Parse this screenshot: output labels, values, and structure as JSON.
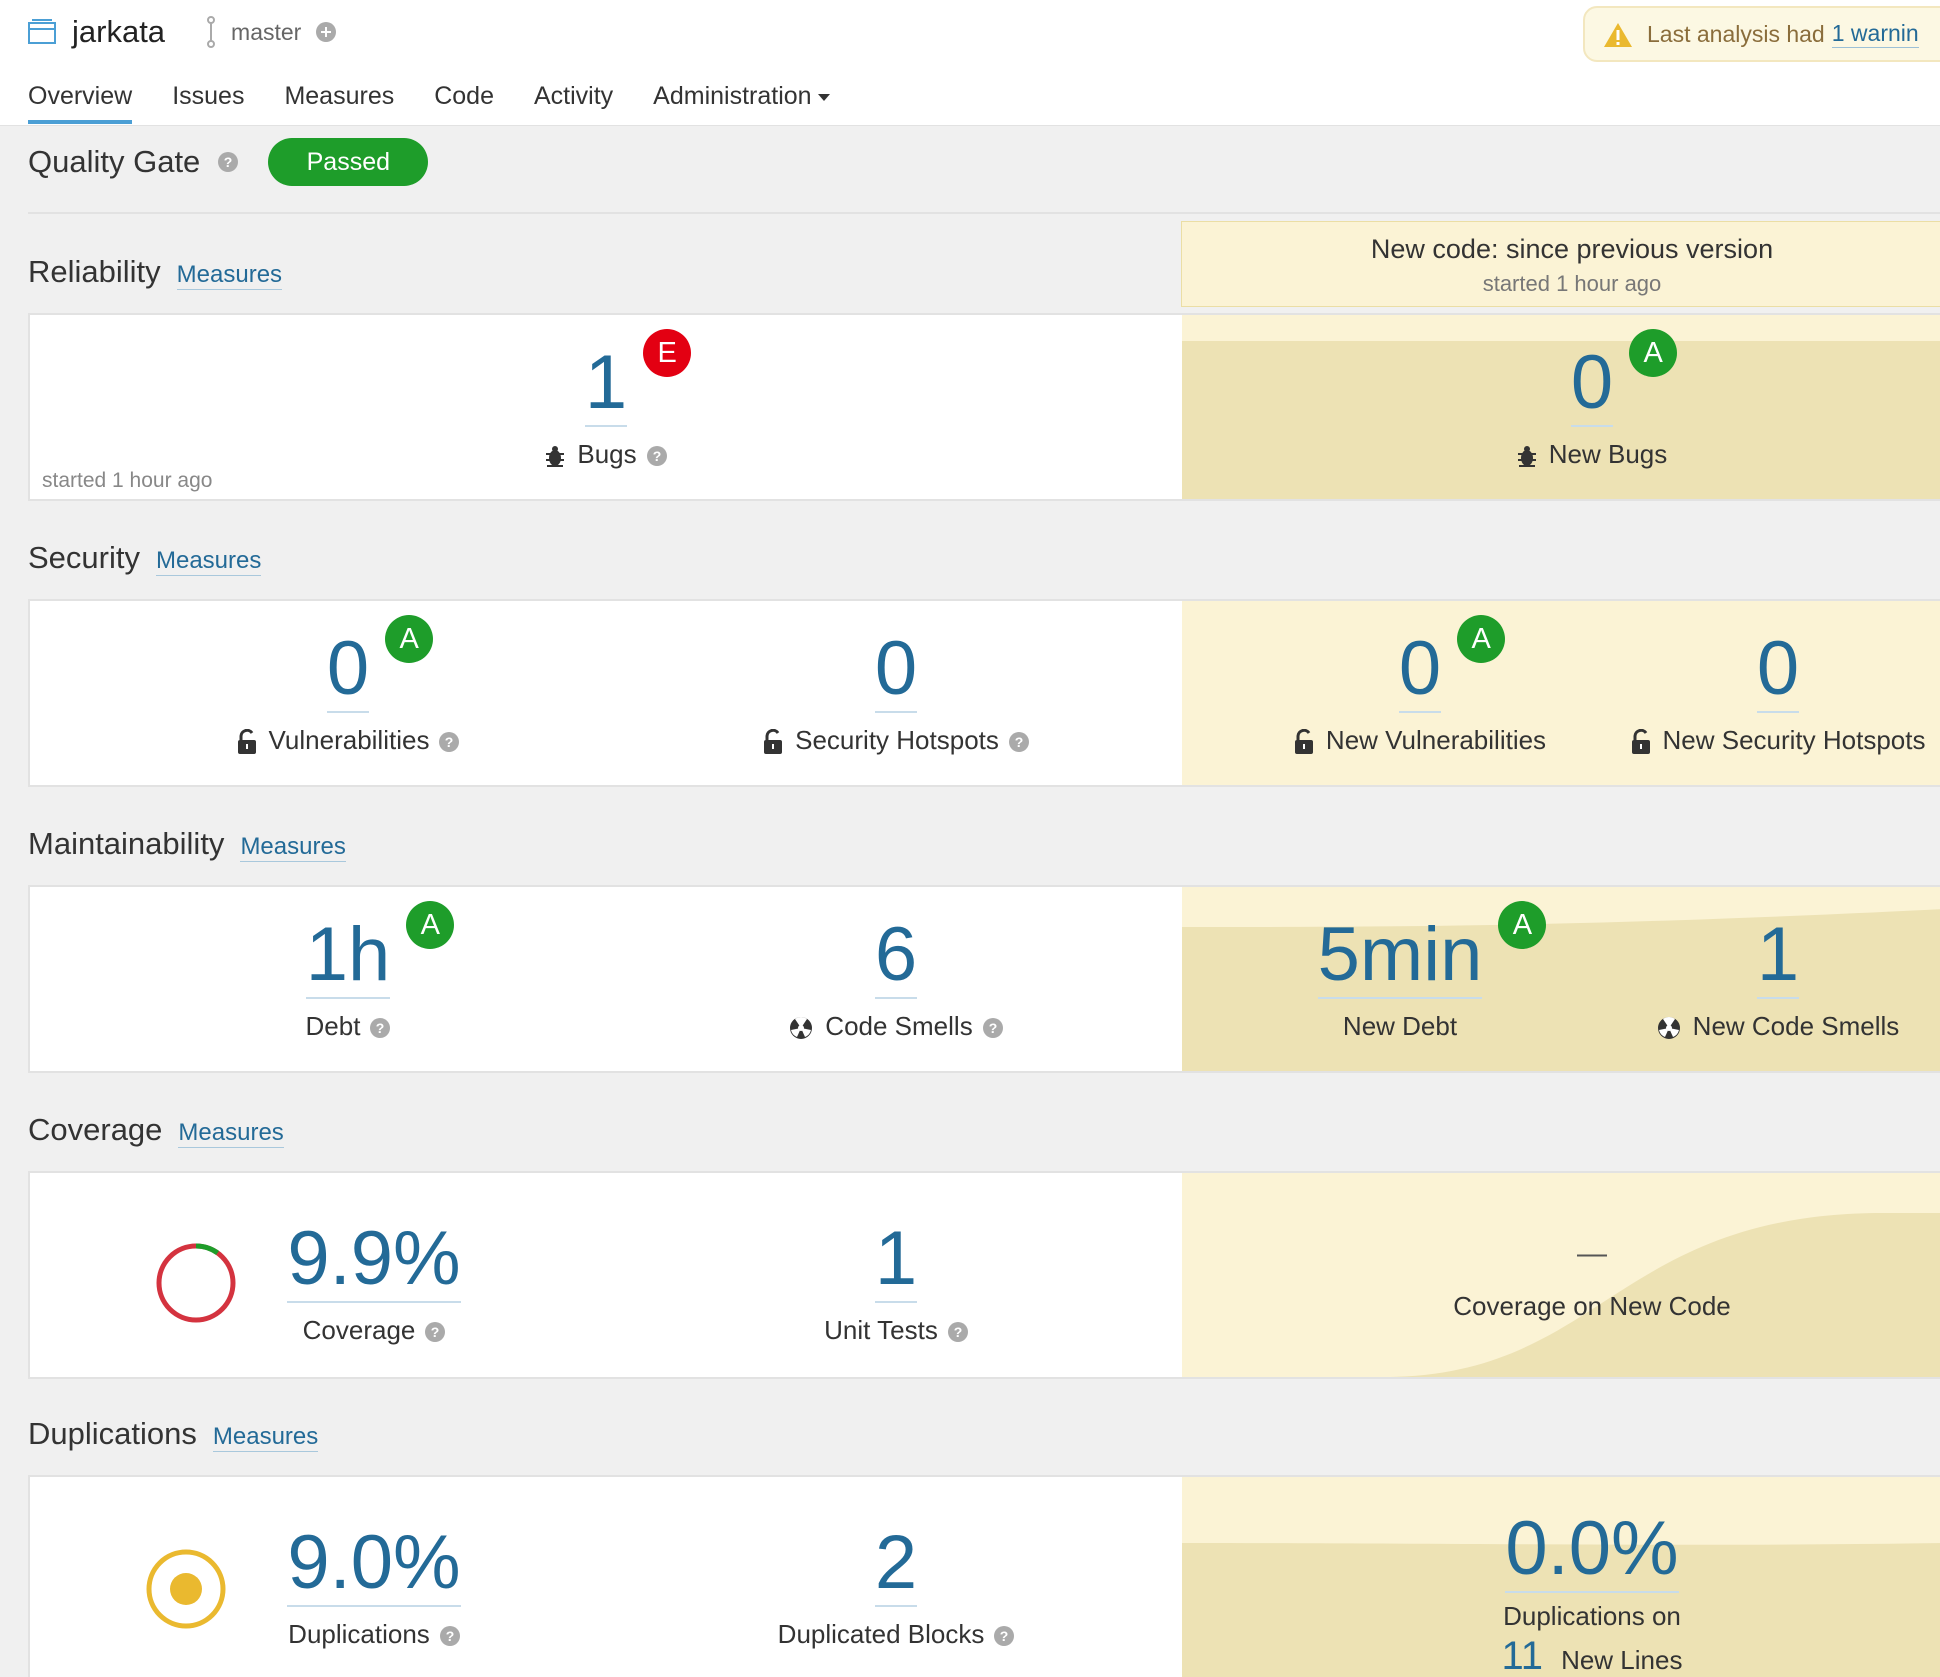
{
  "header": {
    "project_name": "jarkata",
    "branch": "master",
    "warning_text": "Last analysis had",
    "warning_link": "1 warnin"
  },
  "nav": {
    "overview": "Overview",
    "issues": "Issues",
    "measures": "Measures",
    "code": "Code",
    "activity": "Activity",
    "administration": "Administration"
  },
  "quality_gate": {
    "title": "Quality Gate",
    "status": "Passed"
  },
  "new_code": {
    "title": "New code: since previous version",
    "subtitle": "started 1 hour ago"
  },
  "reliability": {
    "title": "Reliability",
    "link": "Measures",
    "started": "started 1 hour ago",
    "bugs": {
      "value": "1",
      "rating": "E",
      "label": "Bugs"
    },
    "new_bugs": {
      "value": "0",
      "rating": "A",
      "label": "New Bugs"
    }
  },
  "security": {
    "title": "Security",
    "link": "Measures",
    "vulnerabilities": {
      "value": "0",
      "rating": "A",
      "label": "Vulnerabilities"
    },
    "hotspots": {
      "value": "0",
      "label": "Security Hotspots"
    },
    "new_vulnerabilities": {
      "value": "0",
      "rating": "A",
      "label": "New Vulnerabilities"
    },
    "new_hotspots": {
      "value": "0",
      "label": "New Security Hotspots"
    }
  },
  "maintainability": {
    "title": "Maintainability",
    "link": "Measures",
    "debt": {
      "value": "1h",
      "rating": "A",
      "label": "Debt"
    },
    "code_smells": {
      "value": "6",
      "label": "Code Smells"
    },
    "new_debt": {
      "value": "5min",
      "rating": "A",
      "label": "New Debt"
    },
    "new_code_smells": {
      "value": "1",
      "label": "New Code Smells"
    }
  },
  "coverage": {
    "title": "Coverage",
    "link": "Measures",
    "coverage": {
      "value": "9.9%",
      "label": "Coverage",
      "percent": 9.9
    },
    "unit_tests": {
      "value": "1",
      "label": "Unit Tests"
    },
    "new_coverage": {
      "value": "—",
      "label": "Coverage on New Code"
    }
  },
  "duplications": {
    "title": "Duplications",
    "link": "Measures",
    "duplications": {
      "value": "9.0%",
      "label": "Duplications"
    },
    "duplicated_blocks": {
      "value": "2",
      "label": "Duplicated Blocks"
    },
    "new_duplications": {
      "value": "0.0%",
      "label": "Duplications on",
      "new_lines_value": "11",
      "new_lines_label": "New Lines"
    }
  },
  "colors": {
    "link_blue": "#236a97",
    "rating_a": "#1e9d2a",
    "rating_e": "#e30012",
    "leak_bg": "#fbf3d5",
    "coverage_red": "#d4333f",
    "coverage_green": "#1e9d2a",
    "duplication_yellow": "#eab92f"
  },
  "icons": [
    "project-icon",
    "branch-icon",
    "plus-circle-icon",
    "warning-icon",
    "help-icon",
    "bug-icon",
    "lock-icon",
    "code-smell-icon",
    "coverage-donut-icon",
    "duplication-ring-icon"
  ]
}
